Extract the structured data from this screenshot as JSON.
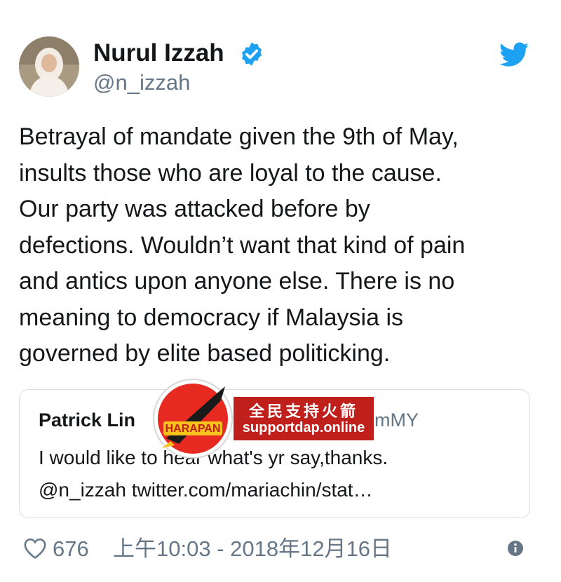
{
  "author": {
    "display_name": "Nurul Izzah",
    "handle": "@n_izzah",
    "avatar": "profile-photo",
    "verified_icon": "verified-badge-icon",
    "platform_icon": "twitter-bird-icon"
  },
  "tweet": {
    "lines": [
      "Betrayal of mandate given the 9th of May,",
      "insults those who are loyal to the cause.",
      "Our party was attacked before by",
      "defections. Wouldn’t want that kind of pain",
      "and antics upon anyone else. There is no",
      "meaning to democracy if Malaysia is",
      "governed by elite based politicking."
    ]
  },
  "quoted_tweet": {
    "name_visible": "Patrick Lin",
    "handle_visible": "imMY",
    "lines": [
      "I would like to hear what's yr say,thanks.",
      "@n_izzah twitter.com/mariachin/stat…"
    ]
  },
  "watermark": {
    "logo_icon": "harapan-rocket-logo",
    "logo_text": "HARAPAN",
    "banner_title": "全民支持火箭",
    "banner_url": "supportdap.online"
  },
  "footer": {
    "like_icon": "heart-icon",
    "like_count": "676",
    "timestamp": "上午10:03 - 2018年12月16日",
    "info_icon": "info-icon"
  },
  "colors": {
    "text": "#14171a",
    "secondary": "#657786",
    "twitter_blue": "#1da1f2",
    "watermark_red": "#c0201c"
  }
}
